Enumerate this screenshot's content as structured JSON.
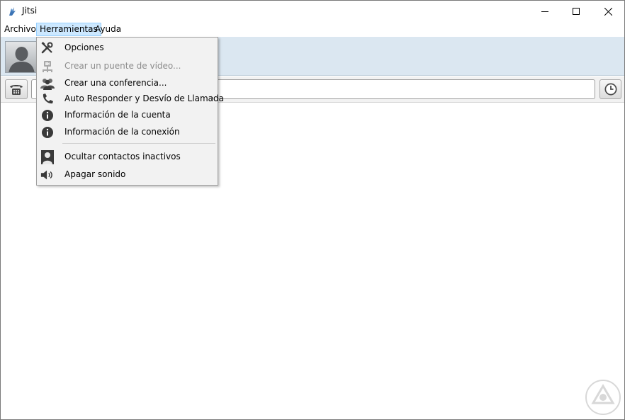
{
  "window": {
    "title": "Jitsi",
    "controls": [
      "minimize",
      "maximize",
      "close"
    ]
  },
  "menubar": {
    "items": [
      {
        "label": "Archivo"
      },
      {
        "label": "Herramientas",
        "active": true
      },
      {
        "label": "Ayuda"
      }
    ]
  },
  "tools_menu": {
    "items": [
      {
        "label": "Opciones",
        "icon": "tools-icon",
        "enabled": true
      },
      {
        "label": "Crear un puente de vídeo...",
        "icon": "video-bridge-icon",
        "enabled": false
      },
      {
        "label": "Crear una conferencia...",
        "icon": "conference-icon",
        "enabled": true
      },
      {
        "label": "Auto Responder y Desvío de Llamada",
        "icon": "phone-icon",
        "enabled": true,
        "submenu": true
      },
      {
        "label": "Información de la cuenta",
        "icon": "info-icon",
        "enabled": true
      },
      {
        "label": "Información de la conexión",
        "icon": "info-icon",
        "enabled": true
      },
      {
        "label": "Ocultar contactos inactivos",
        "icon": "user-icon",
        "enabled": true
      },
      {
        "label": "Apagar sonido",
        "icon": "speaker-icon",
        "enabled": true
      }
    ],
    "submenu_arrow": "›"
  },
  "callbar": {
    "dial_icon": "dialpad-phone-icon",
    "history_icon": "clock-icon",
    "input_value": ""
  },
  "colors": {
    "menu_highlight": "#cce8ff",
    "account_panel_bg": "#dbe7f1",
    "dropdown_bg": "#f2f2f2"
  }
}
